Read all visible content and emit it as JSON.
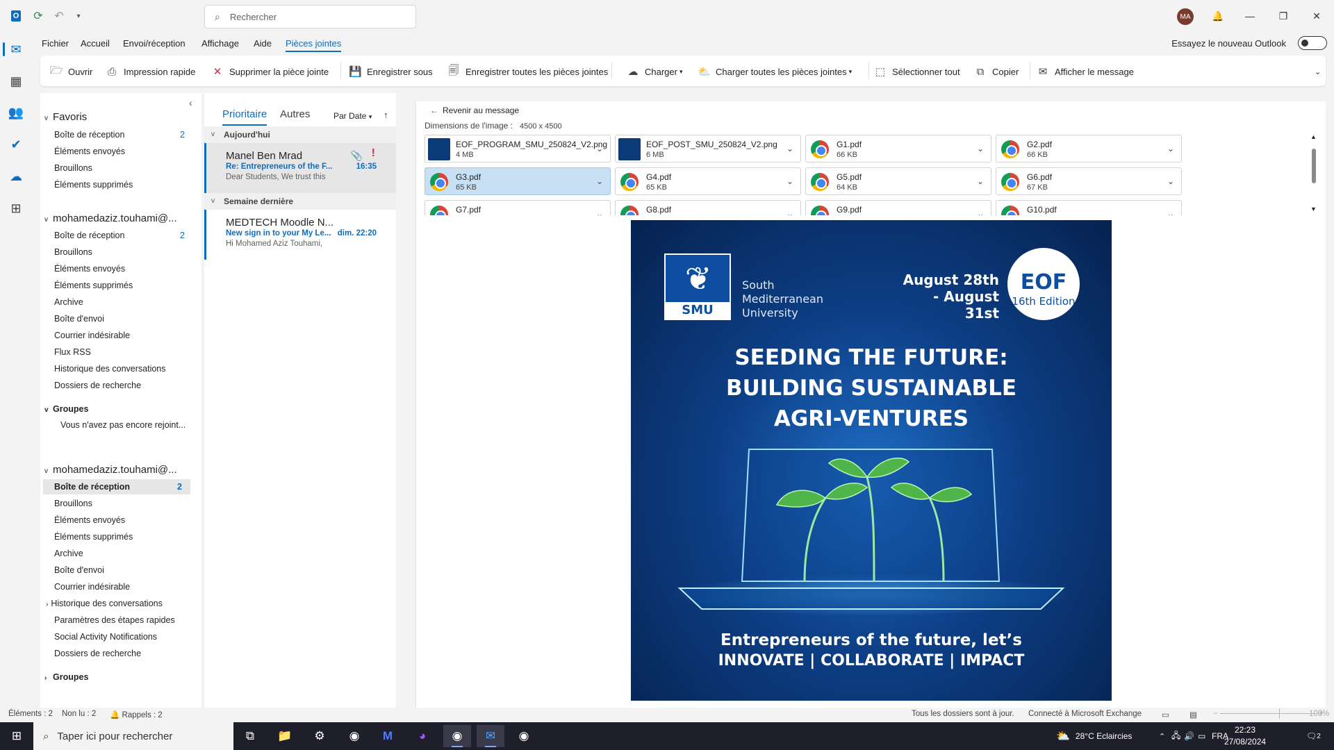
{
  "titlebar": {
    "search_placeholder": "Rechercher",
    "avatar_initials": "MA"
  },
  "menu": {
    "tabs": [
      "Fichier",
      "Accueil",
      "Envoi/réception",
      "Affichage",
      "Aide",
      "Pièces jointes"
    ],
    "active_tab": "Pièces jointes",
    "try_new": "Essayez le nouveau Outlook"
  },
  "ribbon": {
    "open": "Ouvrir",
    "quick_print": "Impression rapide",
    "remove_attachment": "Supprimer la pièce jointe",
    "save_as": "Enregistrer sous",
    "save_all": "Enregistrer toutes les pièces jointes",
    "upload": "Charger",
    "upload_all": "Charger toutes les pièces jointes",
    "select_all": "Sélectionner tout",
    "copy": "Copier",
    "show_message": "Afficher le message"
  },
  "folders": {
    "favorites": {
      "title": "Favoris",
      "items": [
        {
          "label": "Boîte de réception",
          "count": "2"
        },
        {
          "label": "Éléments envoyés",
          "count": ""
        },
        {
          "label": "Brouillons",
          "count": ""
        },
        {
          "label": "Éléments supprimés",
          "count": ""
        }
      ]
    },
    "account1": {
      "title": "mohamedaziz.touhami@...",
      "items": [
        {
          "label": "Boîte de réception",
          "count": "2"
        },
        {
          "label": "Brouillons",
          "count": ""
        },
        {
          "label": "Éléments envoyés",
          "count": ""
        },
        {
          "label": "Éléments supprimés",
          "count": ""
        },
        {
          "label": "Archive",
          "count": ""
        },
        {
          "label": "Boîte d'envoi",
          "count": ""
        },
        {
          "label": "Courrier indésirable",
          "count": ""
        },
        {
          "label": "Flux RSS",
          "count": ""
        },
        {
          "label": "Historique des conversations",
          "count": ""
        },
        {
          "label": "Dossiers de recherche",
          "count": ""
        }
      ],
      "groups_title": "Groupes",
      "groups_note": "Vous n'avez pas encore rejoint..."
    },
    "account2": {
      "title": "mohamedaziz.touhami@...",
      "items": [
        {
          "label": "Boîte de réception",
          "count": "2"
        },
        {
          "label": "Brouillons",
          "count": ""
        },
        {
          "label": "Éléments envoyés",
          "count": ""
        },
        {
          "label": "Éléments supprimés",
          "count": ""
        },
        {
          "label": "Archive",
          "count": ""
        },
        {
          "label": "Boîte d'envoi",
          "count": ""
        },
        {
          "label": "Courrier indésirable",
          "count": ""
        },
        {
          "label": "Historique des conversations",
          "count": ""
        },
        {
          "label": "Paramètres des étapes rapides",
          "count": ""
        },
        {
          "label": "Social Activity Notifications",
          "count": ""
        },
        {
          "label": "Dossiers de recherche",
          "count": ""
        }
      ],
      "groups_title": "Groupes"
    }
  },
  "message_list": {
    "tab_focused": "Prioritaire",
    "tab_other": "Autres",
    "sort": "Par Date",
    "group_today": "Aujourd'hui",
    "group_last_week": "Semaine dernière",
    "mails": [
      {
        "sender": "Manel Ben Mrad",
        "subject": "Re: Entrepreneurs of the F...",
        "preview": "Dear Students,  We trust this",
        "time": "16:35"
      },
      {
        "sender": "MEDTECH Moodle N...",
        "subject": "New sign in to your My Le...",
        "preview": "Hi Mohamed Aziz Touhami,",
        "time": "dim. 22:20"
      }
    ]
  },
  "reading": {
    "back": "Revenir au message",
    "dims_label": "Dimensions de l'image :",
    "dims_value": "4500 x 4500",
    "attachments": [
      {
        "name": "EOF_PROGRAM_SMU_250824_V2.png",
        "size": "4 MB",
        "kind": "image"
      },
      {
        "name": "EOF_POST_SMU_250824_V2.png",
        "size": "6 MB",
        "kind": "image"
      },
      {
        "name": "G1.pdf",
        "size": "66 KB",
        "kind": "pdf"
      },
      {
        "name": "G2.pdf",
        "size": "66 KB",
        "kind": "pdf"
      },
      {
        "name": "G3.pdf",
        "size": "65 KB",
        "kind": "pdf"
      },
      {
        "name": "G4.pdf",
        "size": "65 KB",
        "kind": "pdf"
      },
      {
        "name": "G5.pdf",
        "size": "64 KB",
        "kind": "pdf"
      },
      {
        "name": "G6.pdf",
        "size": "67 KB",
        "kind": "pdf"
      },
      {
        "name": "G7.pdf",
        "size": "",
        "kind": "pdf"
      },
      {
        "name": "G8.pdf",
        "size": "",
        "kind": "pdf"
      },
      {
        "name": "G9.pdf",
        "size": "",
        "kind": "pdf"
      },
      {
        "name": "G10.pdf",
        "size": "",
        "kind": "pdf"
      }
    ],
    "selected_attachment": "G3.pdf"
  },
  "poster": {
    "logo_text": "SMU",
    "university": "South Mediterranean University",
    "dates_line1": "August 28th",
    "dates_line2": "- August 31st",
    "badge_title": "EOF",
    "badge_edition": "16th Edition",
    "headline1": "SEEDING THE FUTURE:",
    "headline2": "BUILDING SUSTAINABLE",
    "headline3": "AGRI-VENTURES",
    "tagline1": "Entrepreneurs of the future, let’s",
    "tagline2": "INNOVATE | COLLABORATE | IMPACT"
  },
  "statusbar": {
    "items": "Éléments : 2",
    "unread": "Non lu : 2",
    "reminders": "Rappels : 2",
    "folders_status": "Tous les dossiers sont à jour.",
    "connection": "Connecté à Microsoft Exchange",
    "zoom": "100%"
  },
  "taskbar": {
    "search_placeholder": "Taper ici pour rechercher",
    "weather": "28°C  Eclaircies",
    "language": "FRA",
    "time": "22:23",
    "date": "27/08/2024",
    "notifications": "2"
  }
}
